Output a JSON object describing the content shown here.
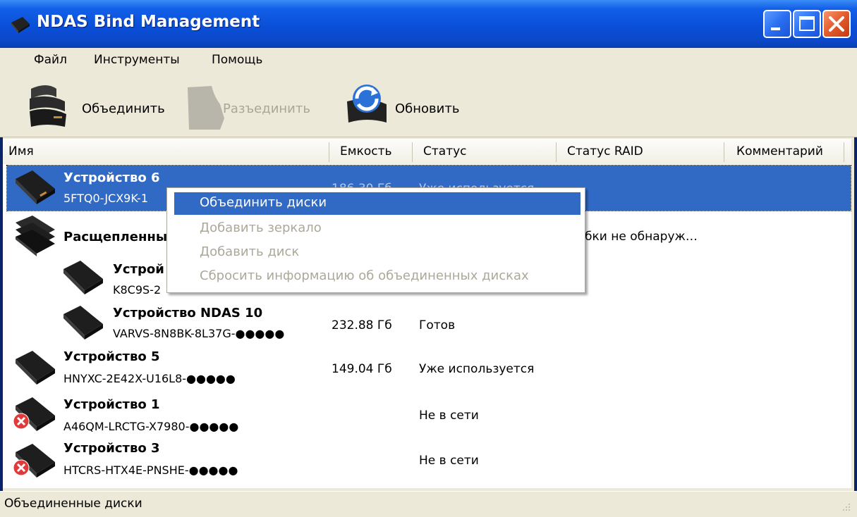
{
  "window": {
    "title": "NDAS Bind Management"
  },
  "menu": [
    "Файл",
    "Инструменты",
    "Помощь"
  ],
  "toolbar": {
    "bind_label": "Объединить",
    "unbind_label": "Разъединить",
    "refresh_label": "Обновить"
  },
  "columns": {
    "name": "Имя",
    "capacity": "Емкость",
    "status": "Статус",
    "raid_status": "Статус RAID",
    "comment": "Комментарий"
  },
  "rows": [
    {
      "name": "Устройство 6",
      "serial": "5FTQ0-JCX9K-1",
      "capacity": "186.30 Гб",
      "status": "Уже используется",
      "selected": true
    },
    {
      "name": "Расщепленны",
      "raid_status": "ибки не обнаруж…",
      "group": true
    },
    {
      "name": "Устрой",
      "serial": "K8C9S-2",
      "child": true
    },
    {
      "name": "Устройство NDAS 10",
      "serial": "VARVS-8N8BK-8L37G-●●●●●",
      "capacity": "232.88 Гб",
      "status": "Готов",
      "child": true
    },
    {
      "name": "Устройство 5",
      "serial": "HNYXC-2E42X-U16L8-●●●●●",
      "capacity": "149.04 Гб",
      "status": "Уже используется"
    },
    {
      "name": "Устройство 1",
      "serial": "A46QM-LRCTG-X7980-●●●●●",
      "status": "Не в сети",
      "offline": true
    },
    {
      "name": "Устройство 3",
      "serial": "HTCRS-HTX4E-PNSHE-●●●●●",
      "status": "Не в сети",
      "offline": true
    }
  ],
  "context_menu": [
    {
      "label": "Объединить диски",
      "state": "highlighted"
    },
    {
      "label": "Добавить зеркало",
      "state": "disabled"
    },
    {
      "label": "Добавить диск",
      "state": "disabled"
    },
    {
      "label": "Сбросить информацию об объединенных дисках",
      "state": "disabled"
    }
  ],
  "statusbar": {
    "text": "Объединенные диски"
  },
  "colors": {
    "selection": "#316ac5",
    "titlebar": "#0a4fd8",
    "face": "#ece9d8"
  }
}
